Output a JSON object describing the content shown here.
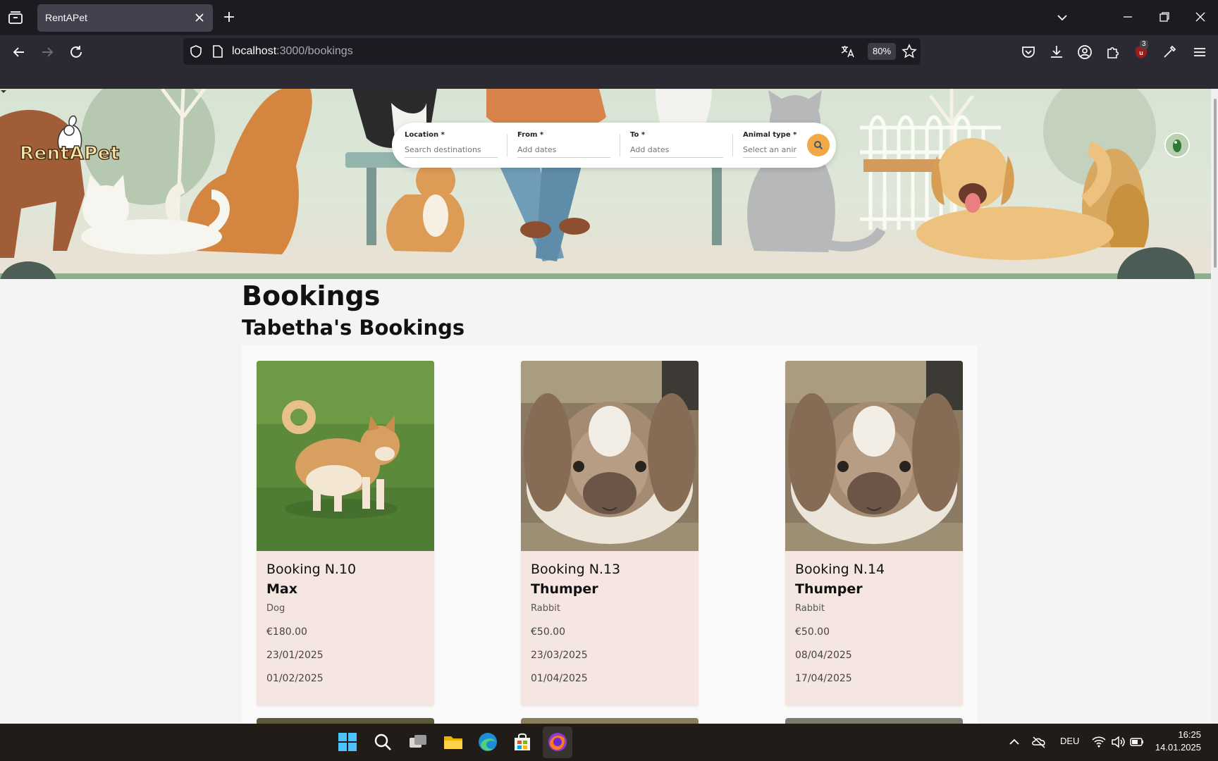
{
  "browser": {
    "tab_title": "RentAPet",
    "url_host": "localhost",
    "url_path": ":3000/bookings",
    "zoom": "80%",
    "extension_badge": "3"
  },
  "site": {
    "logo_text": "RentAPet",
    "search": {
      "location_label": "Location",
      "location_placeholder": "Search destinations",
      "from_label": "From",
      "from_placeholder": "Add dates",
      "to_label": "To",
      "to_placeholder": "Add dates",
      "animal_label": "Animal type",
      "animal_placeholder": "Select an animal",
      "required_mark": "*"
    }
  },
  "page": {
    "title": "Bookings",
    "subtitle": "Tabetha's Bookings",
    "bookings": [
      {
        "number": "Booking N.10",
        "pet_name": "Max",
        "pet_type": "Dog",
        "price": "€180.00",
        "from": "23/01/2025",
        "to": "01/02/2025"
      },
      {
        "number": "Booking N.13",
        "pet_name": "Thumper",
        "pet_type": "Rabbit",
        "price": "€50.00",
        "from": "23/03/2025",
        "to": "01/04/2025"
      },
      {
        "number": "Booking N.14",
        "pet_name": "Thumper",
        "pet_type": "Rabbit",
        "price": "€50.00",
        "from": "08/04/2025",
        "to": "17/04/2025"
      }
    ]
  },
  "taskbar": {
    "language": "DEU",
    "time": "16:25",
    "date": "14.01.2025"
  },
  "colors": {
    "accent_orange": "#f2a845",
    "card_bg": "#f6e6e2",
    "browser_dark": "#1c1b22",
    "browser_nav": "#2b2a33"
  }
}
